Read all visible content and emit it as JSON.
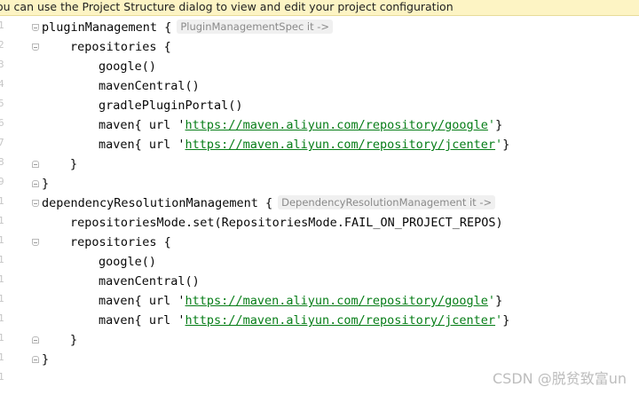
{
  "banner": {
    "text": "ou can use the Project Structure dialog to view and edit your project configuration"
  },
  "code": {
    "l1": "pluginManagement {",
    "l1_hint": "PluginManagementSpec it ->",
    "l2": "repositories {",
    "l3": "google()",
    "l4": "mavenCentral()",
    "l5": "gradlePluginPortal()",
    "l6_pre": "maven{ url '",
    "l6_url": "https://maven.aliyun.com/repository/google",
    "l6_post_q": "'",
    "l6_post": "}",
    "l7_pre": "maven{ url '",
    "l7_url": "https://maven.aliyun.com/repository/jcenter",
    "l7_post_q": "'",
    "l7_post": "}",
    "l8": "}",
    "l9": "}",
    "l10": "dependencyResolutionManagement {",
    "l10_hint": "DependencyResolutionManagement it ->",
    "l11": "repositoriesMode.set(RepositoriesMode.FAIL_ON_PROJECT_REPOS)",
    "l12": "repositories {",
    "l13": "google()",
    "l14": "mavenCentral()",
    "l15_pre": "maven{ url '",
    "l15_url": "https://maven.aliyun.com/repository/google",
    "l15_post_q": "'",
    "l15_post": "}",
    "l16_pre": "maven{ url '",
    "l16_url": "https://maven.aliyun.com/repository/jcenter",
    "l16_post_q": "'",
    "l16_post": "}",
    "l17": "}",
    "l18": "}"
  },
  "watermark": "CSDN @脱贫致富un",
  "colors": {
    "string": "#067d17",
    "hint_bg": "#f0f0f0",
    "banner_bg": "#fdf4c4"
  }
}
